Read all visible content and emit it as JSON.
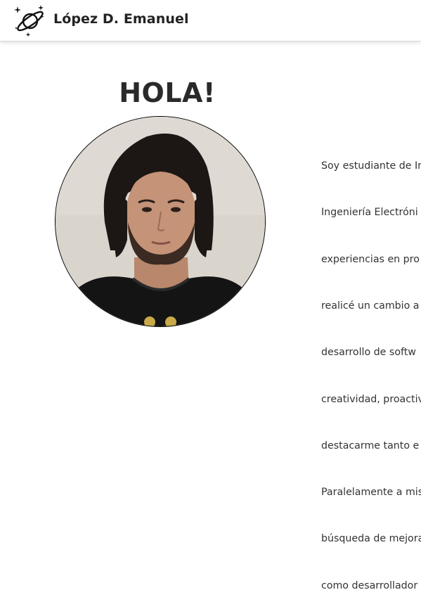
{
  "navbar": {
    "brand": "López D. Emanuel",
    "logo_icon": "planet-ring-stars-icon"
  },
  "hero": {
    "greeting": "HOLA!",
    "avatar_icon": "profile-photo",
    "bio_lines": [
      "Soy estudiante de In",
      "Ingeniería Electróni",
      "experiencias en pro",
      "realicé un cambio a",
      "desarrollo de softw",
      "creatividad, proactiv",
      "destacarme tanto e",
      "Paralelamente a mis",
      "búsqueda de mejora",
      "como desarrollador"
    ]
  },
  "colors": {
    "text": "#2b2b2b",
    "navbar_bg": "#ffffff",
    "navbar_border": "#d9d9d9"
  }
}
